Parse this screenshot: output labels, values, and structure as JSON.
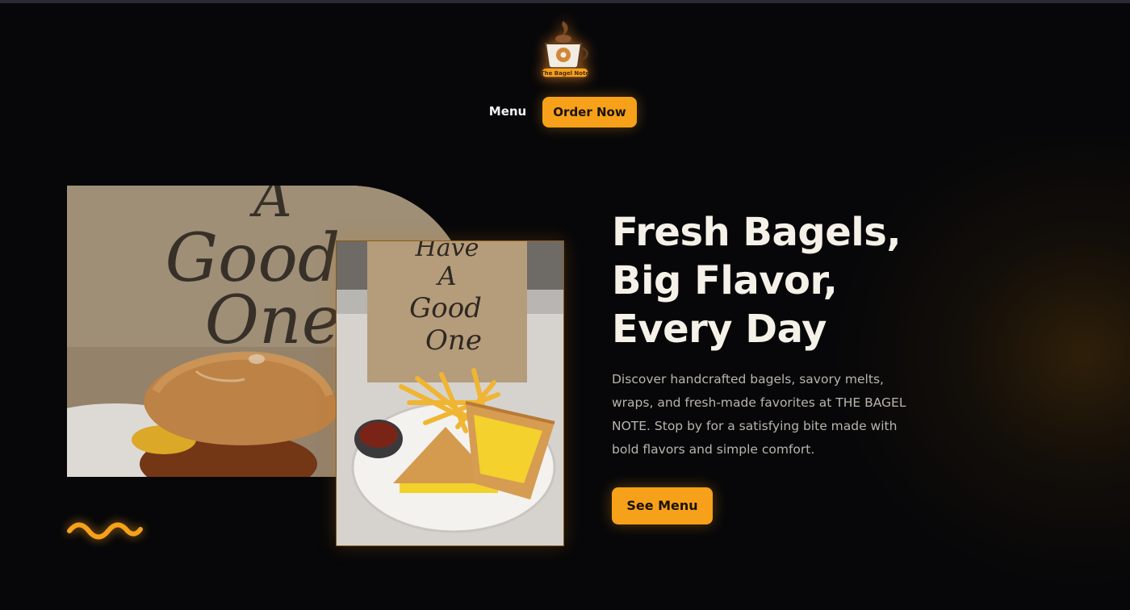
{
  "brand": {
    "logo_text": "The Bagel Note",
    "logo_icon": "coffee-cup-bagel-logo"
  },
  "nav": {
    "menu_label": "Menu",
    "order_label": "Order Now"
  },
  "images": {
    "back_sign_text": [
      "A",
      "Good",
      "One"
    ],
    "front_sign_text": [
      "Have",
      "A",
      "Good",
      "One"
    ]
  },
  "hero": {
    "title_lines": [
      "Fresh Bagels,",
      "Big Flavor,",
      "Every Day"
    ],
    "description": "Discover handcrafted bagels, savory melts, wraps, and fresh-made favorites at THE BAGEL NOTE. Stop by for a satisfying bite made with bold flavors and simple comfort.",
    "cta_label": "See Menu"
  },
  "colors": {
    "background": "#070709",
    "accent": "#f7a11a",
    "title": "#f6f1e8",
    "body_text": "#b9b4ad"
  }
}
